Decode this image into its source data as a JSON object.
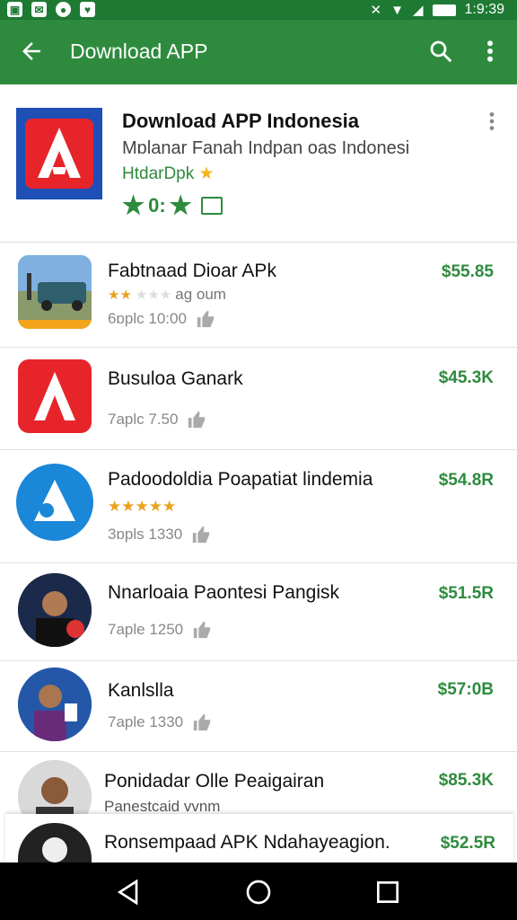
{
  "status_bar": {
    "time": "1:9:39"
  },
  "app_bar": {
    "title": "Download APP"
  },
  "header": {
    "title": "Download APP Indonesia",
    "subtitle": "Mɒlanar Fanah Indpan oas Indonesi",
    "developer": "HtdarDpk",
    "rating_text": "0:"
  },
  "apps": [
    {
      "name": "Fabtnaad Dioar APk",
      "price": "$55.85",
      "stars_text": "ag oum",
      "meta": "6ɒplc 10:00"
    },
    {
      "name": "Busuloa Ganark",
      "price": "$45.3K",
      "meta": "7aplc 7.50"
    },
    {
      "name": "Padoodoldia Poapatiat lindemia",
      "price": "$54.8R",
      "meta": "3ɒpls 1330"
    },
    {
      "name": "Nnarloaia Paontesi Pangisk",
      "price": "$51.5R",
      "meta": "7aple 1250"
    },
    {
      "name": "Kanlslla",
      "price": "$57:0B",
      "meta": "7aple 1330"
    },
    {
      "name": "Ponidadar Olle Peaigairan",
      "price": "$85.3K",
      "meta": "Panestcaid vvnm"
    },
    {
      "name": "Ronsempaad APK Ndahayeagion.",
      "price": "$52.5R"
    }
  ],
  "colors": {
    "brand": "#2e8b3e",
    "status": "#1e7a33",
    "star": "#f2b51d"
  },
  "icons": [
    "arrow-back-icon",
    "search-icon",
    "more-vert-icon",
    "star-icon",
    "thumb-up-icon",
    "nav-back-icon",
    "nav-home-icon",
    "nav-recents-icon"
  ]
}
